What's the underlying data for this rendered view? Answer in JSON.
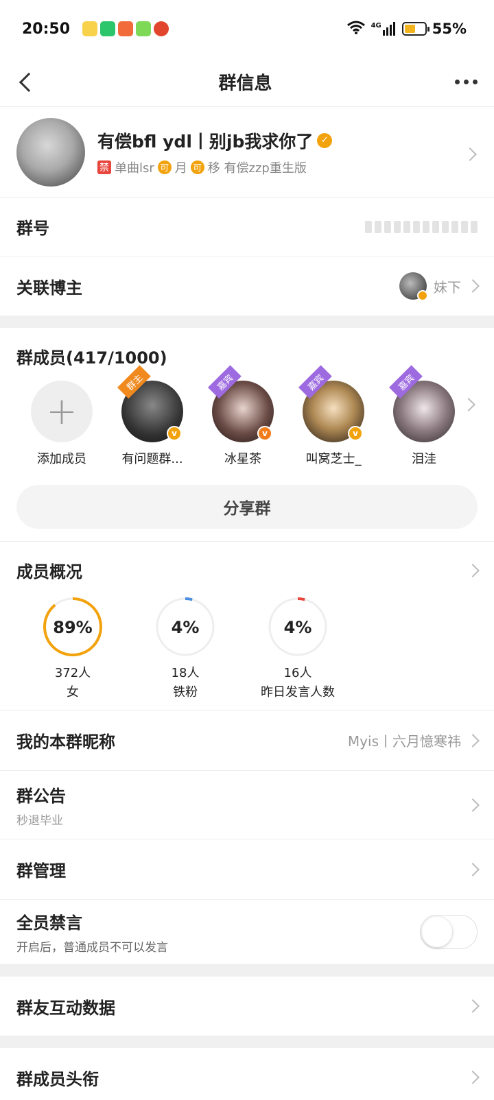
{
  "status_bar": {
    "time": "20:50",
    "network": "4G",
    "battery": "55%",
    "battery_level": 0.55,
    "app_icons": [
      "weibo-icon",
      "wechat-icon",
      "app-icon",
      "video-icon",
      "car-icon"
    ]
  },
  "nav": {
    "title": "群信息"
  },
  "group": {
    "name": "有偿bfl ydl丨别jb我求你了",
    "tag_ban": "禁",
    "tag_text_1": "单曲lsr",
    "tag_k1": "可",
    "tag_text_2": "月",
    "tag_k2": "可",
    "tag_text_3": "移 有偿zzp重生版"
  },
  "rows": {
    "group_id_label": "群号",
    "linked_blogger_label": "关联博主",
    "linked_blogger_name": "妹下"
  },
  "members": {
    "title": "群成员(417/1000)",
    "list": [
      {
        "label": "添加成员"
      },
      {
        "label": "有问题群...",
        "ribbon": "群主"
      },
      {
        "label": "冰星茶",
        "ribbon": "嘉宾"
      },
      {
        "label": "叫窝芝士_",
        "ribbon": "嘉宾"
      },
      {
        "label": "泪洼",
        "ribbon": "嘉宾"
      }
    ],
    "share_label": "分享群"
  },
  "overview": {
    "title": "成员概况",
    "stats": [
      {
        "percent": "89%",
        "value": 0.89,
        "count": "372人",
        "label": "女",
        "color": "#f2a20c"
      },
      {
        "percent": "4%",
        "value": 0.04,
        "count": "18人",
        "label": "铁粉",
        "color": "#4a90e2"
      },
      {
        "percent": "4%",
        "value": 0.04,
        "count": "16人",
        "label": "昨日发言人数",
        "color": "#e8453c"
      }
    ]
  },
  "settings": {
    "nickname_label": "我的本群昵称",
    "nickname_value": "Myis丨六月憶寒祎",
    "notice_label": "群公告",
    "notice_sub": "秒退毕业",
    "manage_label": "群管理",
    "mute_label": "全员禁言",
    "mute_sub": "开启后，普通成员不可以发言",
    "interaction_label": "群友互动数据",
    "titles_label": "群成员头衔"
  }
}
